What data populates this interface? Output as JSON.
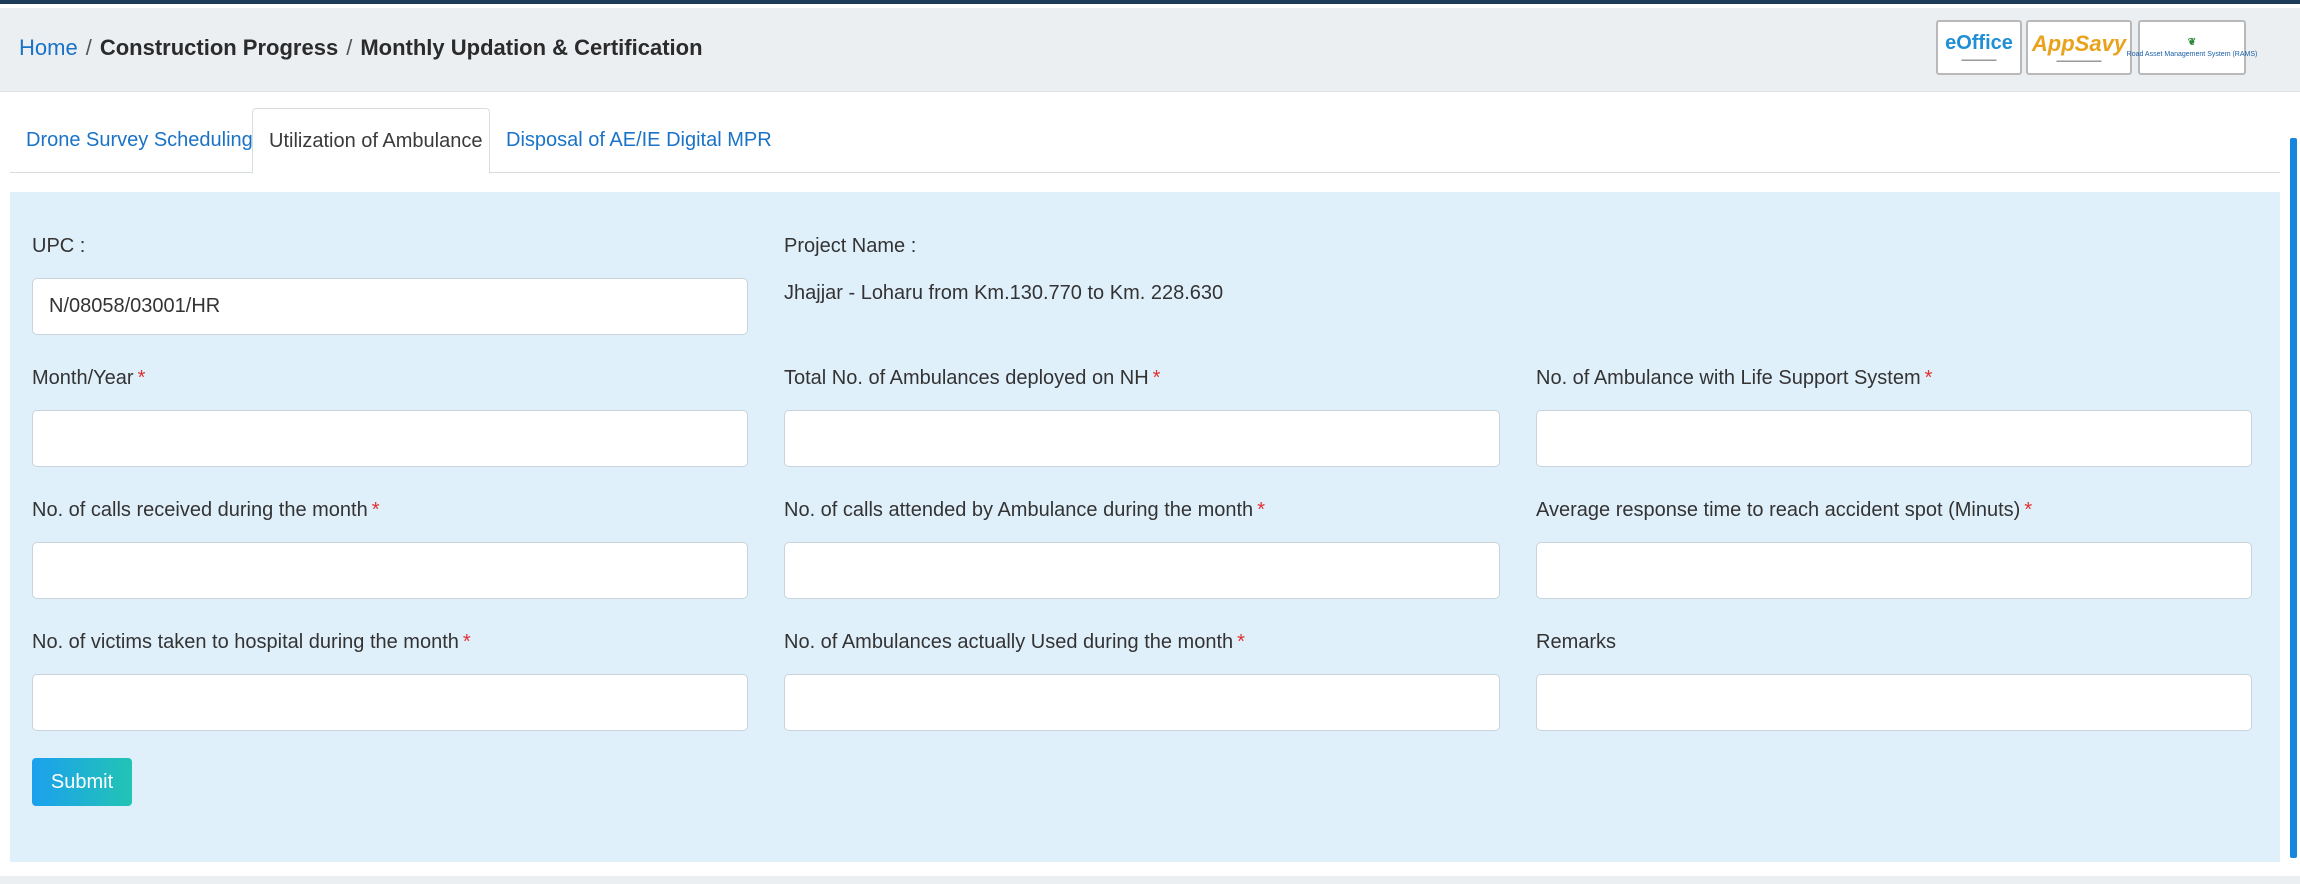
{
  "breadcrumb": {
    "home": "Home",
    "separator": "/",
    "level1": "Construction Progress",
    "level2": "Monthly Updation & Certification"
  },
  "logos": {
    "eoffice": "eOffice",
    "appsavy": "AppSavy",
    "ram": "Road Asset Management System (RAMS)"
  },
  "tabs": [
    {
      "label": "Drone Survey Scheduling",
      "active": false
    },
    {
      "label": "Utilization of Ambulance",
      "active": true
    },
    {
      "label": "Disposal of AE/IE Digital MPR",
      "active": false
    }
  ],
  "form": {
    "upc_label": "UPC :",
    "upc_value": "N/08058/03001/HR",
    "project_name_label": "Project Name :",
    "project_name_value": "Jhajjar - Loharu from Km.130.770 to Km. 228.630",
    "required_mark": "*",
    "fields": {
      "month_year": "Month/Year",
      "total_ambulances": "Total No. of Ambulances deployed on NH",
      "life_support": "No. of Ambulance with Life Support System",
      "calls_received": "No. of calls received during the month",
      "calls_attended": "No. of calls attended by Ambulance during the month",
      "avg_response": "Average response time to reach accident spot (Minuts)",
      "victims": "No. of victims taken to hospital during the month",
      "ambulances_used": "No. of Ambulances actually Used during the month",
      "remarks": "Remarks"
    },
    "submit_label": "Submit"
  },
  "colors": {
    "link": "#1a73c7",
    "panel_bg": "#e0f0fb",
    "required": "#e03030",
    "button_start": "#1ba0ee",
    "button_end": "#22c4b4"
  }
}
